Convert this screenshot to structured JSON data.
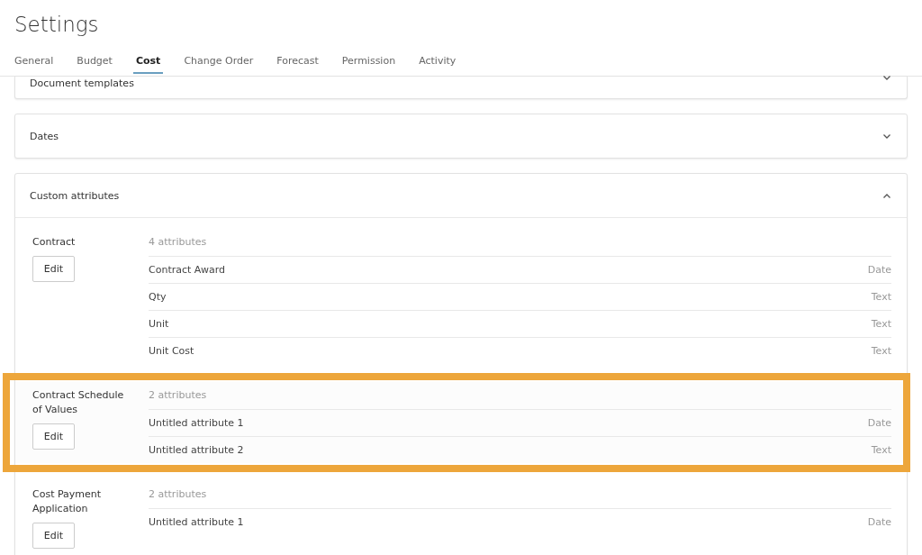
{
  "title": "Settings",
  "tabs": [
    {
      "label": "General",
      "selected": false
    },
    {
      "label": "Budget",
      "selected": false
    },
    {
      "label": "Cost",
      "selected": true
    },
    {
      "label": "Change Order",
      "selected": false
    },
    {
      "label": "Forecast",
      "selected": false
    },
    {
      "label": "Permission",
      "selected": false
    },
    {
      "label": "Activity",
      "selected": false
    }
  ],
  "sections": [
    {
      "title": "Document templates",
      "expanded": false
    },
    {
      "title": "Dates",
      "expanded": false
    },
    {
      "title": "Custom attributes",
      "expanded": true,
      "groups": [
        {
          "name": "Contract",
          "button": "Edit",
          "count": "4 attributes",
          "highlighted": false,
          "attributes": [
            {
              "name": "Contract Award",
              "type": "Date"
            },
            {
              "name": "Qty",
              "type": "Text"
            },
            {
              "name": "Unit",
              "type": "Text"
            },
            {
              "name": "Unit Cost",
              "type": "Text"
            }
          ]
        },
        {
          "name": "Contract Schedule of Values",
          "button": "Edit",
          "count": "2 attributes",
          "highlighted": true,
          "attributes": [
            {
              "name": "Untitled attribute 1",
              "type": "Date"
            },
            {
              "name": "Untitled attribute 2",
              "type": "Text"
            }
          ]
        },
        {
          "name": "Cost Payment Application",
          "button": "Edit",
          "count": "2 attributes",
          "highlighted": false,
          "attributes": [
            {
              "name": "Untitled attribute 1",
              "type": "Date"
            }
          ]
        }
      ]
    }
  ]
}
